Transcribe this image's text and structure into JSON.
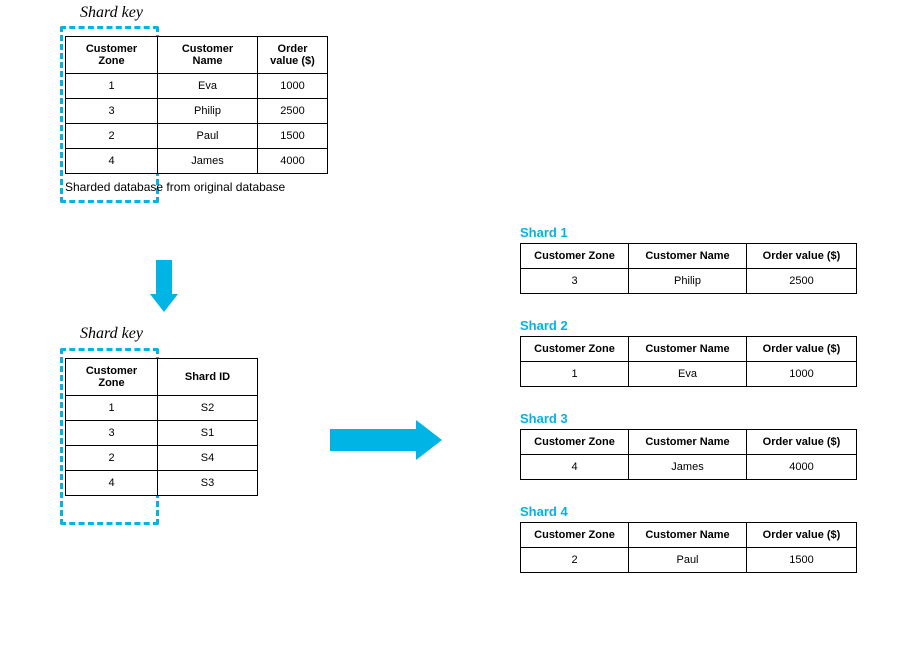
{
  "labels": {
    "shard_key_top": "Shard key",
    "shard_key_bottom": "Shard key",
    "caption": "Sharded database from original database"
  },
  "original_table": {
    "headers": {
      "c0": "Customer Zone",
      "c1": "Customer Name",
      "c2": "Order value ($)"
    },
    "rows": [
      {
        "c0": "1",
        "c1": "Eva",
        "c2": "1000"
      },
      {
        "c0": "3",
        "c1": "Philip",
        "c2": "2500"
      },
      {
        "c0": "2",
        "c1": "Paul",
        "c2": "1500"
      },
      {
        "c0": "4",
        "c1": "James",
        "c2": "4000"
      }
    ]
  },
  "lookup_table": {
    "headers": {
      "c0": "Customer Zone",
      "c1": "Shard ID"
    },
    "rows": [
      {
        "c0": "1",
        "c1": "S2"
      },
      {
        "c0": "3",
        "c1": "S1"
      },
      {
        "c0": "2",
        "c1": "S4"
      },
      {
        "c0": "4",
        "c1": "S3"
      }
    ]
  },
  "shards": [
    {
      "title": "Shard 1",
      "headers": {
        "c0": "Customer Zone",
        "c1": "Customer Name",
        "c2": "Order value ($)"
      },
      "rows": [
        {
          "c0": "3",
          "c1": "Philip",
          "c2": "2500"
        }
      ]
    },
    {
      "title": "Shard 2",
      "headers": {
        "c0": "Customer Zone",
        "c1": "Customer Name",
        "c2": "Order value ($)"
      },
      "rows": [
        {
          "c0": "1",
          "c1": "Eva",
          "c2": "1000"
        }
      ]
    },
    {
      "title": "Shard 3",
      "headers": {
        "c0": "Customer Zone",
        "c1": "Customer Name",
        "c2": "Order value ($)"
      },
      "rows": [
        {
          "c0": "4",
          "c1": "James",
          "c2": "4000"
        }
      ]
    },
    {
      "title": "Shard 4",
      "headers": {
        "c0": "Customer Zone",
        "c1": "Customer Name",
        "c2": "Order value ($)"
      },
      "rows": [
        {
          "c0": "2",
          "c1": "Paul",
          "c2": "1500"
        }
      ]
    }
  ]
}
